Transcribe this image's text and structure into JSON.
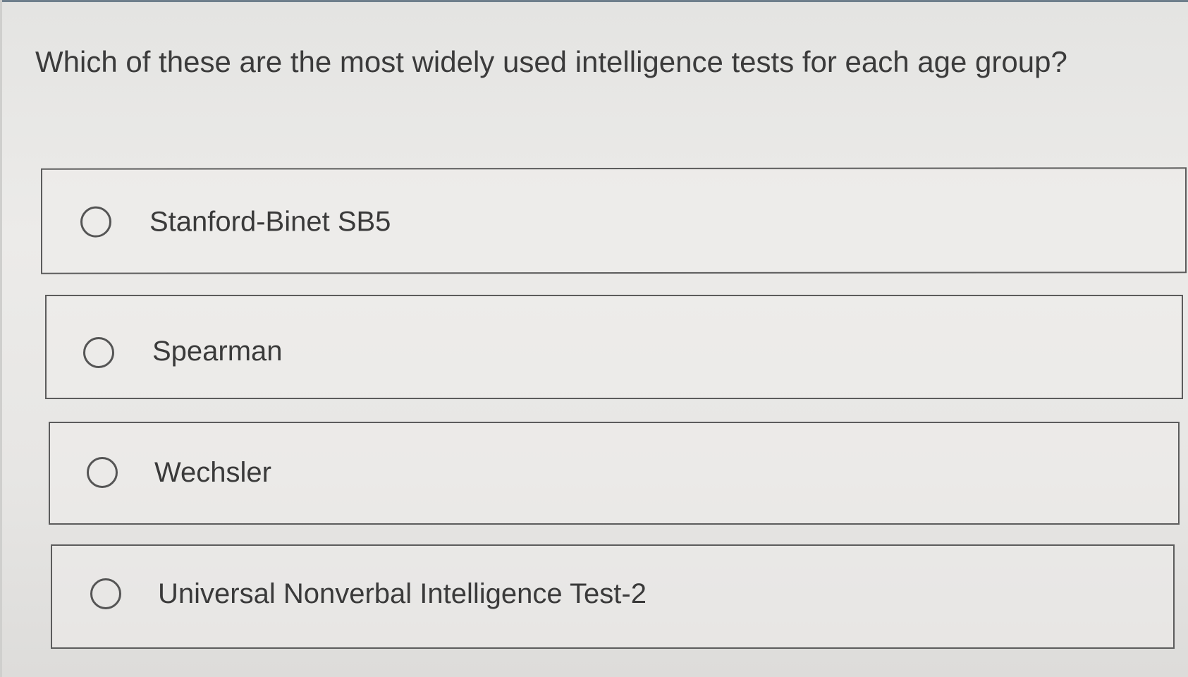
{
  "question": {
    "text": "Which of these are the most widely used intelligence tests for each age group?"
  },
  "options": [
    {
      "label": "Stanford-Binet SB5",
      "selected": false
    },
    {
      "label": "Spearman",
      "selected": false
    },
    {
      "label": "Wechsler",
      "selected": false
    },
    {
      "label": "Universal Nonverbal Intelligence Test-2",
      "selected": false
    }
  ],
  "colors": {
    "background": "#e8e7e5",
    "border": "#5c5c5c",
    "text": "#3a3a3a"
  }
}
